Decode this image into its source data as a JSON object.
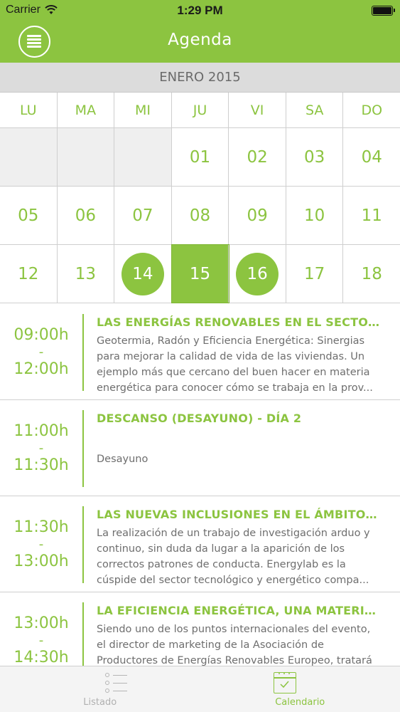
{
  "status_bar": {
    "carrier": "Carrier",
    "time": "1:29 PM"
  },
  "nav": {
    "title": "Agenda",
    "menu_icon": "menu-icon"
  },
  "calendar": {
    "month_label": "ENERO 2015",
    "weekdays": [
      "LU",
      "MA",
      "MI",
      "JU",
      "VI",
      "SA",
      "DO"
    ],
    "weeks": [
      [
        "",
        "",
        "",
        "01",
        "02",
        "03",
        "04"
      ],
      [
        "05",
        "06",
        "07",
        "08",
        "09",
        "10",
        "11"
      ],
      [
        "12",
        "13",
        "14",
        "15",
        "16",
        "17",
        "18"
      ]
    ],
    "event_days": [
      "14",
      "16"
    ],
    "selected_day": "15"
  },
  "events": [
    {
      "start": "09:00h",
      "sep": "-",
      "end": "12:00h",
      "title": "LAS ENERGÍAS RENOVABLES EN EL SECTOR...",
      "desc": "Geotermia, Radón y Eficiencia Energética: Sinergias para mejorar la calidad de vida de las viviendas. Un ejemplo más que cercano del buen hacer en materia energética para conocer cómo se trabaja en la prov..."
    },
    {
      "start": "11:00h",
      "sep": "-",
      "end": "11:30h",
      "title": "DESCANSO (DESAYUNO) - DÍA 2",
      "desc": "Desayuno"
    },
    {
      "start": "11:30h",
      "sep": "-",
      "end": "13:00h",
      "title": "LAS NUEVAS INCLUSIONES EN EL ÁMBITO D...",
      "desc": "La realización de un trabajo de investigación arduo y continuo, sin duda da lugar a la aparición de los correctos patrones de conducta. Energylab es la cúspide del sector tecnológico y energético compa..."
    },
    {
      "start": "13:00h",
      "sep": "-",
      "end": "14:30h",
      "title": "LA EFICIENCIA ENERGÉTICA, UNA MATERIA...",
      "desc": "Siendo uno de los puntos internacionales del evento, el director de marketing de la Asociación de Productores de Energías Renovables Europeo, tratará"
    }
  ],
  "tabbar": {
    "tabs": [
      {
        "label": "Listado",
        "icon": "list-icon",
        "active": false
      },
      {
        "label": "Calendario",
        "icon": "calendar-icon",
        "active": true
      }
    ]
  },
  "colors": {
    "accent": "#8cc440",
    "text_gray": "#6e6e6e",
    "month_bg": "#dcdcdc"
  }
}
